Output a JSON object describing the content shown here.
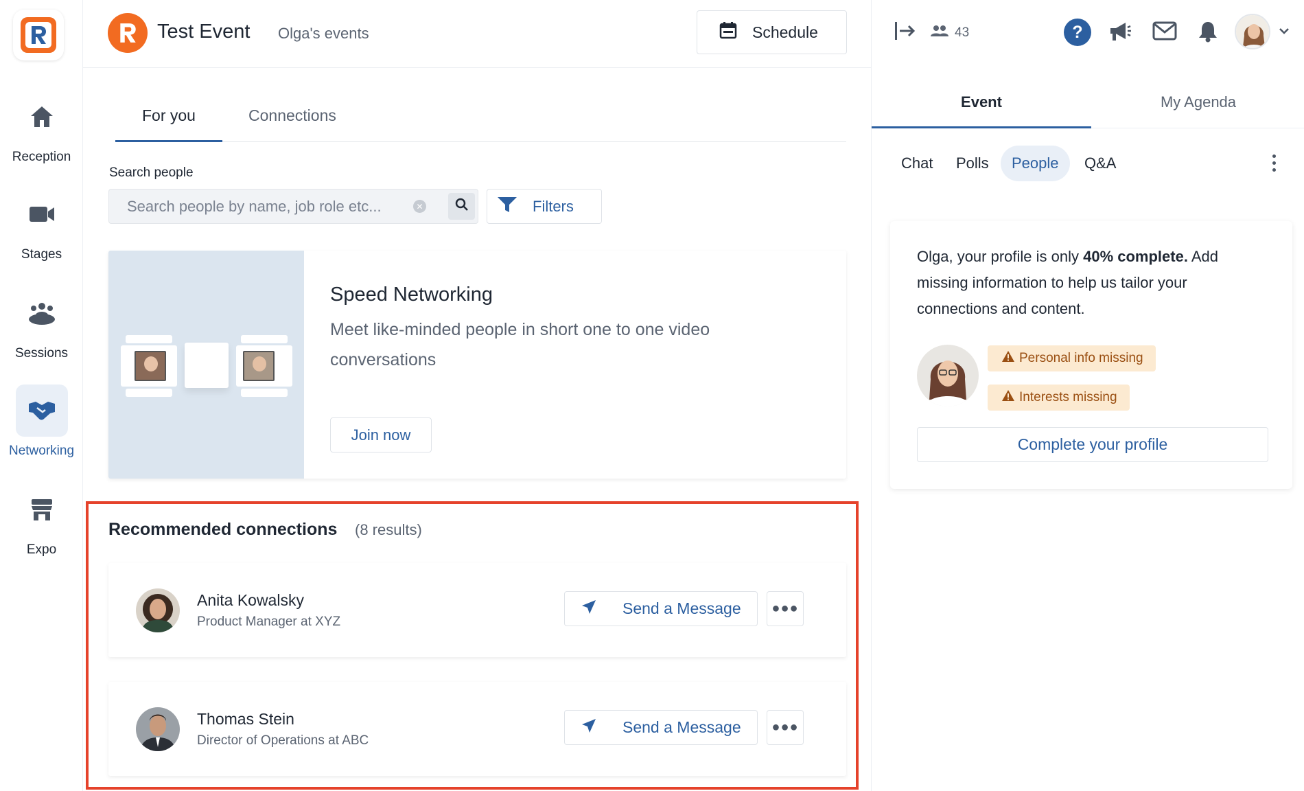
{
  "sidebar": {
    "items": [
      {
        "label": "Reception",
        "icon": "home-icon"
      },
      {
        "label": "Stages",
        "icon": "video-camera-icon"
      },
      {
        "label": "Sessions",
        "icon": "group-icon"
      },
      {
        "label": "Networking",
        "icon": "handshake-icon"
      },
      {
        "label": "Expo",
        "icon": "store-icon"
      }
    ]
  },
  "header": {
    "title": "Test Event",
    "subtitle": "Olga's events",
    "schedule_label": "Schedule"
  },
  "main": {
    "tabs": [
      {
        "label": "For you"
      },
      {
        "label": "Connections"
      }
    ],
    "search": {
      "label": "Search people",
      "placeholder": "Search people by name, job role etc..."
    },
    "filters_label": "Filters",
    "speed_networking": {
      "title": "Speed Networking",
      "description": "Meet like-minded people in short one to one video conversations",
      "join_label": "Join now"
    },
    "recommended": {
      "title": "Recommended connections",
      "count": "(8 results)",
      "people": [
        {
          "name": "Anita Kowalsky",
          "role": "Product Manager at XYZ",
          "action": "Send a Message"
        },
        {
          "name": "Thomas Stein",
          "role": "Director of Operations at ABC",
          "action": "Send a Message"
        }
      ]
    }
  },
  "right_panel": {
    "attendee_count": "43",
    "tabs": [
      {
        "label": "Event"
      },
      {
        "label": "My Agenda"
      }
    ],
    "sub_tabs": [
      {
        "label": "Chat"
      },
      {
        "label": "Polls"
      },
      {
        "label": "People"
      },
      {
        "label": "Q&A"
      }
    ],
    "profile": {
      "text_prefix": "Olga, your profile is only ",
      "text_bold": "40% complete.",
      "text_suffix": " Add missing information to help us tailor your connections and content.",
      "badges": [
        "Personal info missing",
        "Interests missing"
      ],
      "complete_label": "Complete your profile"
    },
    "help_glyph": "?"
  },
  "colors": {
    "accent": "#2c5fa0",
    "brand_orange": "#f26b21",
    "highlight_border": "#e5422b",
    "warning_bg": "#fcead1"
  }
}
